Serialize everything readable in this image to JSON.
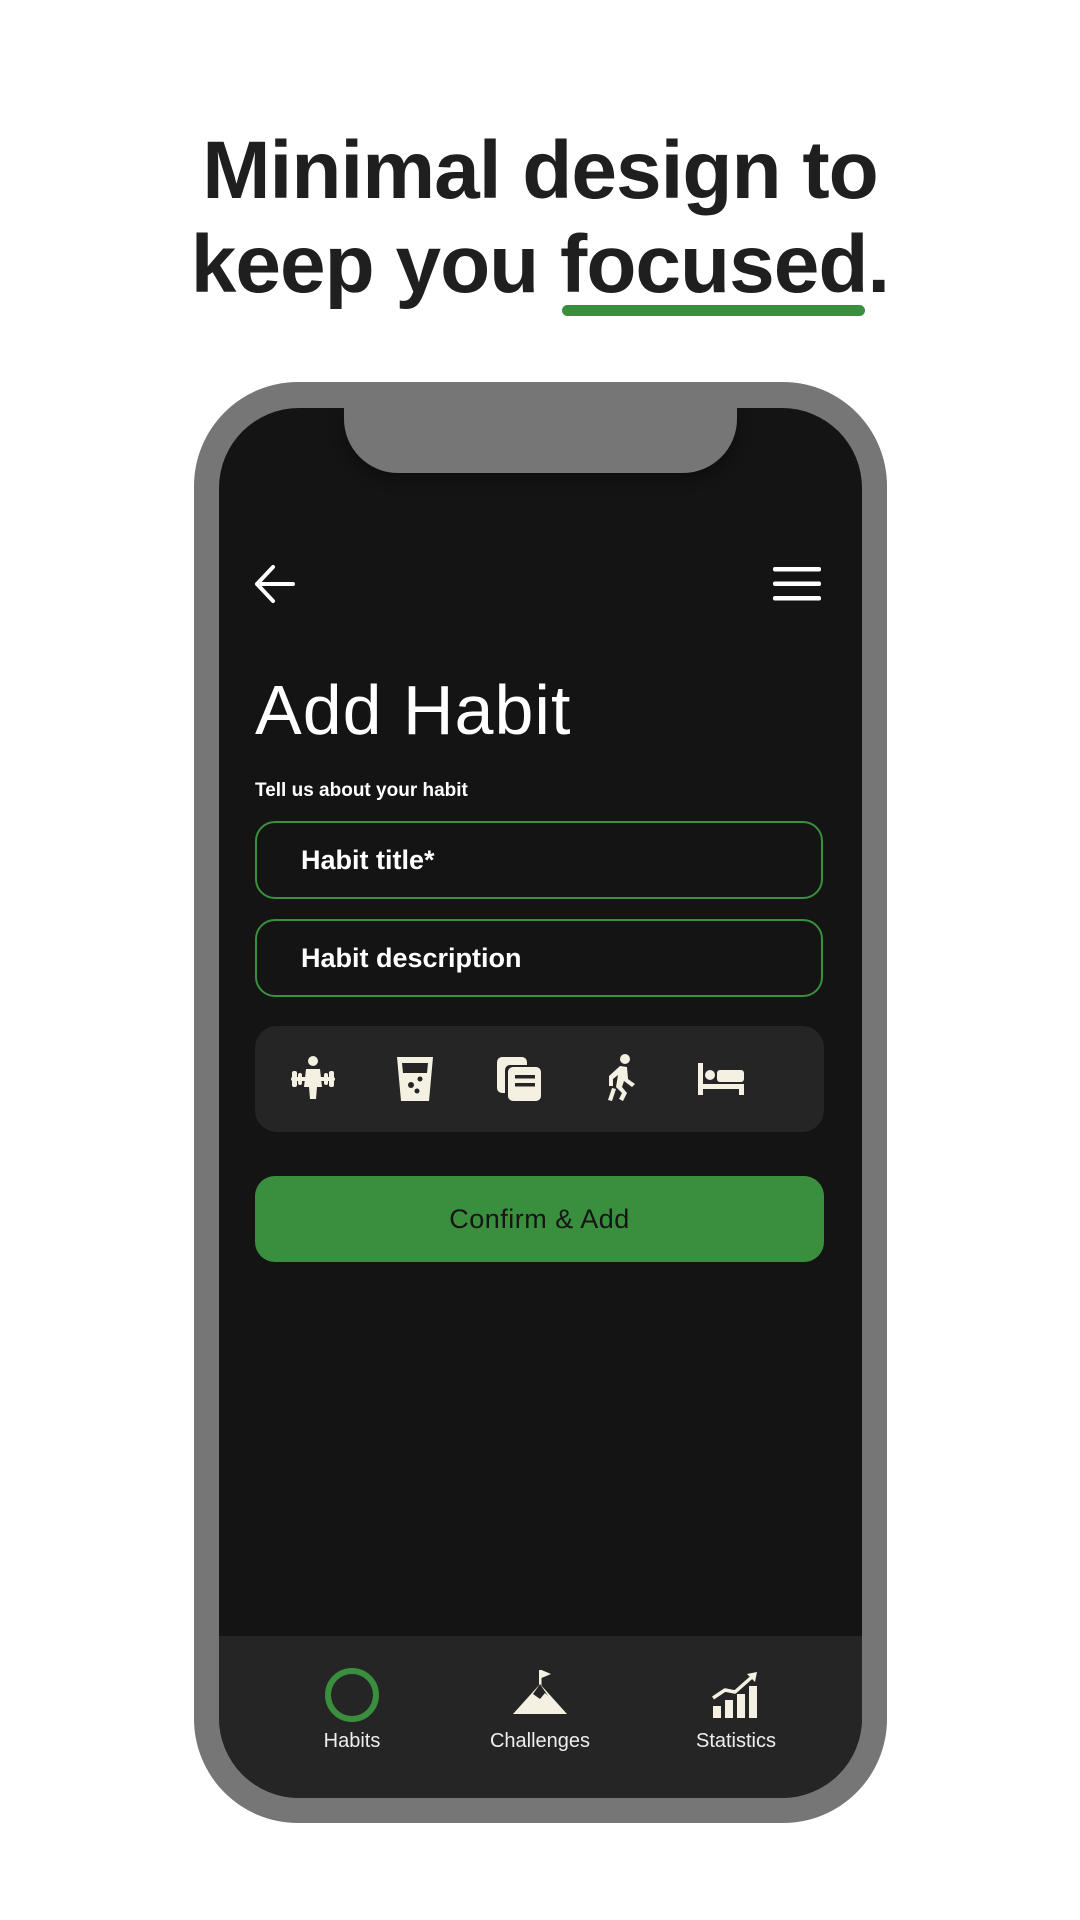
{
  "headline": {
    "line1": "Minimal design to",
    "line2_before": "keep you ",
    "line2_highlight": "focused",
    "line2_after": "."
  },
  "screen": {
    "title": "Add Habit",
    "subtitle": "Tell us about your habit",
    "fields": {
      "title_placeholder": "Habit title*",
      "description_placeholder": "Habit description"
    },
    "habit_icons": [
      "weightlifting-icon",
      "water-glass-icon",
      "books-icon",
      "walking-icon",
      "bed-icon"
    ],
    "confirm_label": "Confirm & Add"
  },
  "nav": {
    "items": [
      {
        "label": "Habits",
        "icon": "ring-icon",
        "active": true
      },
      {
        "label": "Challenges",
        "icon": "mountain-flag-icon",
        "active": false
      },
      {
        "label": "Statistics",
        "icon": "bar-chart-icon",
        "active": false
      }
    ]
  },
  "colors": {
    "accent": "#3a8f3f",
    "screen_bg": "#141414",
    "panel_bg": "#252525",
    "frame": "#767676",
    "icon_fill": "#f4f1e3"
  }
}
